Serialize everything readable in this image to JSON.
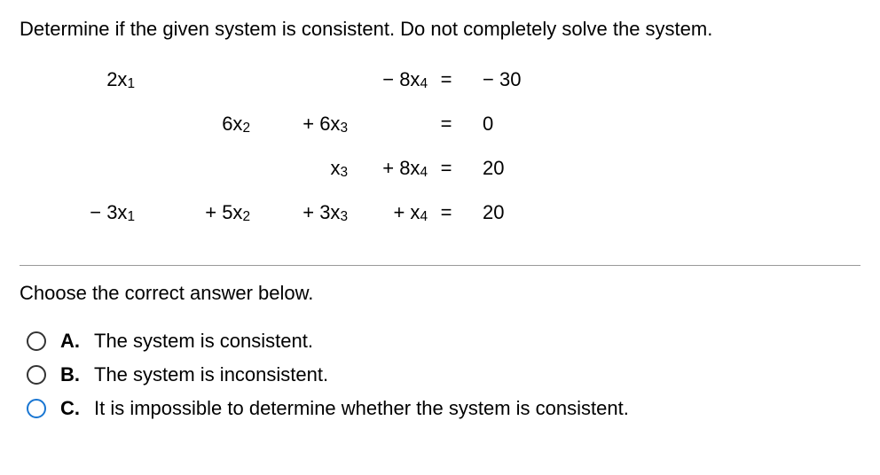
{
  "question": "Determine if the given system is consistent. Do not completely solve the system.",
  "equations": {
    "r1": {
      "c1": "2x",
      "s1": "1",
      "c2": "",
      "s2": "",
      "c3": "",
      "s3": "",
      "c4p": "− 8x",
      "s4": "4",
      "eq": "=",
      "rhs": "− 30"
    },
    "r2": {
      "c1": "",
      "s1": "",
      "c2": "6x",
      "s2": "2",
      "c3": "+ 6x",
      "s3": "3",
      "c4p": "",
      "s4": "",
      "eq": "=",
      "rhs": "0"
    },
    "r3": {
      "c1": "",
      "s1": "",
      "c2": "",
      "s2": "",
      "c3": "x",
      "s3": "3",
      "c4p": "+ 8x",
      "s4": "4",
      "eq": "=",
      "rhs": "20"
    },
    "r4": {
      "c1": "− 3x",
      "s1": "1",
      "c2": "+ 5x",
      "s2": "2",
      "c3": "+ 3x",
      "s3": "3",
      "c4p": "+  x",
      "s4": "4",
      "eq": "=",
      "rhs": "20"
    }
  },
  "prompt": "Choose the correct answer below.",
  "choices": {
    "a": {
      "letter": "A.",
      "text": "The system is consistent."
    },
    "b": {
      "letter": "B.",
      "text": "The system is inconsistent."
    },
    "c": {
      "letter": "C.",
      "text": "It is impossible to determine whether the system is consistent."
    }
  }
}
